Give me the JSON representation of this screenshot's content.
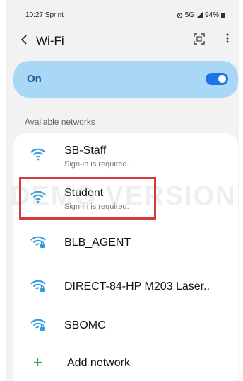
{
  "status_bar": {
    "time": "10:27 Sprint",
    "indicators": "5G",
    "battery": "94%"
  },
  "header": {
    "back_icon": "chevron-left-icon",
    "title": "Wi-Fi",
    "scan_icon": "qr-scan-icon",
    "more_icon": "more-vertical-icon"
  },
  "master_toggle": {
    "label": "On",
    "state": "on",
    "accent": "#1a73e8",
    "card_color": "#a9d7f6"
  },
  "available": {
    "section_label": "Available networks",
    "networks": [
      {
        "name": "SB-Staff",
        "subtitle": "Sign-in is required.",
        "icon": "wifi-icon",
        "secured": false
      },
      {
        "name": "Student",
        "subtitle": "Sign-in is required.",
        "icon": "wifi-icon",
        "secured": false,
        "highlighted": true
      },
      {
        "name": "BLB_AGENT",
        "icon": "wifi-lock-icon",
        "secured": true
      },
      {
        "name": "DIRECT-84-HP M203 Laser..",
        "icon": "wifi-lock-icon",
        "secured": true
      },
      {
        "name": "SBOMC",
        "icon": "wifi-lock-icon",
        "secured": true
      }
    ]
  },
  "add_network": {
    "icon": "plus-icon",
    "label": "Add network"
  },
  "watermark": "DEMO VERSION",
  "highlight_color": "#d03b3f"
}
